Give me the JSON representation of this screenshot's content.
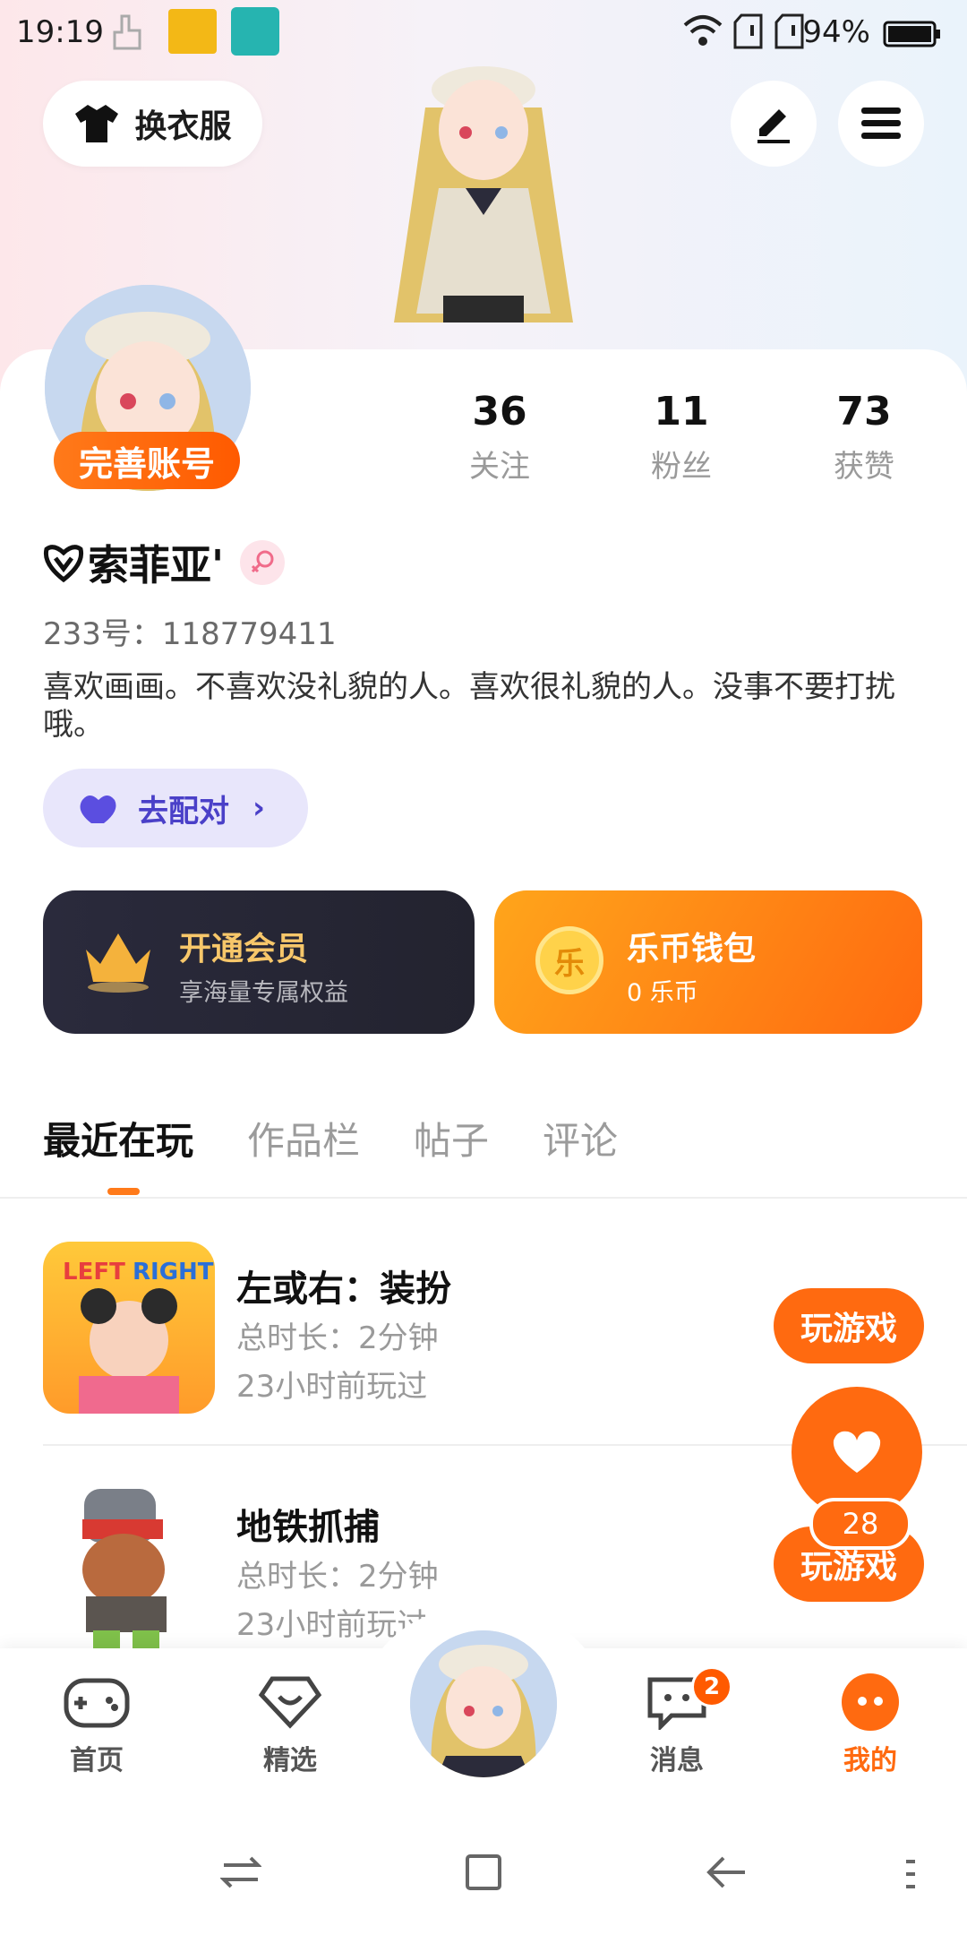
{
  "status_bar": {
    "time": "19:19",
    "battery": "94%"
  },
  "header": {
    "outfit_button": "换衣服"
  },
  "profile": {
    "finish_account": "完善账号",
    "stats": [
      {
        "num": "36",
        "label": "关注"
      },
      {
        "num": "11",
        "label": "粉丝"
      },
      {
        "num": "73",
        "label": "获赞"
      }
    ],
    "name": "索菲亚'",
    "uid": "233号：118779411",
    "bio": "喜欢画画。不喜欢没礼貌的人。喜欢很礼貌的人。没事不要打扰哦。",
    "pair_button": "去配对"
  },
  "cards": {
    "vip_title": "开通会员",
    "vip_sub": "享海量专属权益",
    "wallet_title": "乐币钱包",
    "wallet_sub": "0 乐币",
    "coin_char": "乐"
  },
  "tabs": [
    "最近在玩",
    "作品栏",
    "帖子",
    "评论"
  ],
  "games": [
    {
      "title": "左或右：装扮",
      "duration": "总时长：2分钟",
      "last": "23小时前玩过",
      "action": "玩游戏",
      "thumb_text_left": "LEFT",
      "thumb_text_right": "RIGHT"
    },
    {
      "title": "地铁抓捕",
      "duration": "总时长：2分钟",
      "last": "23小时前玩过",
      "action": "玩游戏"
    }
  ],
  "fab": {
    "count": "28"
  },
  "bottom_nav": [
    {
      "label": "首页"
    },
    {
      "label": "精选"
    },
    {
      "label": "消息",
      "badge": "2"
    },
    {
      "label": "我的"
    }
  ],
  "colors": {
    "accent": "#ff6a10",
    "vip_bg": "#26262f",
    "pair_bg": "#e8e6fb"
  }
}
